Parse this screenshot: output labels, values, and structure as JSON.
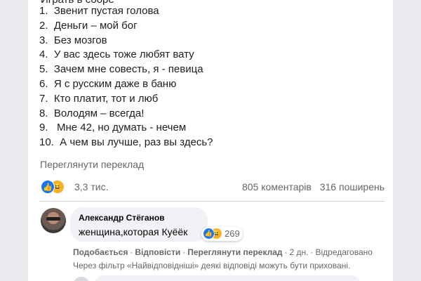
{
  "post": {
    "partial_line": "Играть в сборе",
    "list": [
      "1.  Звенит пустая голова",
      "2.  Деньги – мой бог",
      "3.  Без мозгов",
      "4.  У вас здесь тоже любят вату",
      "5.  Зачем мне совесть, я - певица",
      "6.  Я с русским даже в баню",
      "7.  Кто платит, тот и люб",
      "8.  Володям – всегда!",
      "9.   Мне 42, но думать - нечем",
      "10.  А чем вы лучше, раз вы здесь?"
    ],
    "see_translation": "Переглянути переклад"
  },
  "stats": {
    "reaction_icons": [
      "like-icon",
      "haha-icon"
    ],
    "reaction_count": "3,3 тис.",
    "comments": "805 коментарів",
    "shares": "316 поширень"
  },
  "comment": {
    "author": "Александр Стёганов",
    "text": "женщина,которая Куёёк",
    "reaction_icons": [
      "like-icon",
      "haha-icon"
    ],
    "reaction_count": "269",
    "actions": {
      "like": "Подобається",
      "reply": "Відповісти",
      "translate": "Переглянути переклад",
      "time": "2 дн.",
      "edited": "Відредаговано",
      "dot": "·"
    },
    "filter_note": "Через фільтр «Найвідповідніші» деякі відповіді можуть бути приховані."
  },
  "colors": {
    "like": "#1877f2",
    "haha": "#f7b125",
    "muted_text": "#65676b",
    "bubble": "#f0f2f5"
  }
}
